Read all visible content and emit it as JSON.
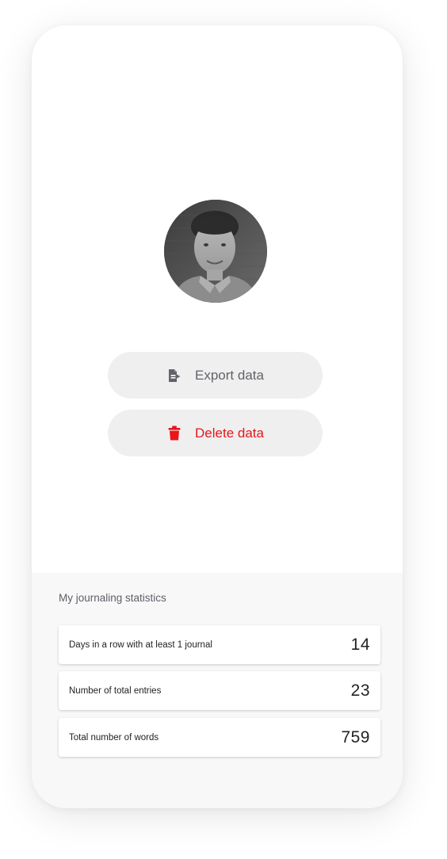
{
  "profile": {
    "avatar": "user-profile-photo"
  },
  "actions": {
    "export": {
      "label": "Export data",
      "icon": "export-file-icon",
      "color": "#62636a"
    },
    "delete": {
      "label": "Delete data",
      "icon": "trash-icon",
      "color": "#e8151b"
    }
  },
  "stats": {
    "title": "My journaling statistics",
    "items": [
      {
        "label": "Days in a row with at least 1 journal",
        "value": "14"
      },
      {
        "label": "Number of total entries",
        "value": "23"
      },
      {
        "label": "Total number of words",
        "value": "759"
      }
    ]
  }
}
